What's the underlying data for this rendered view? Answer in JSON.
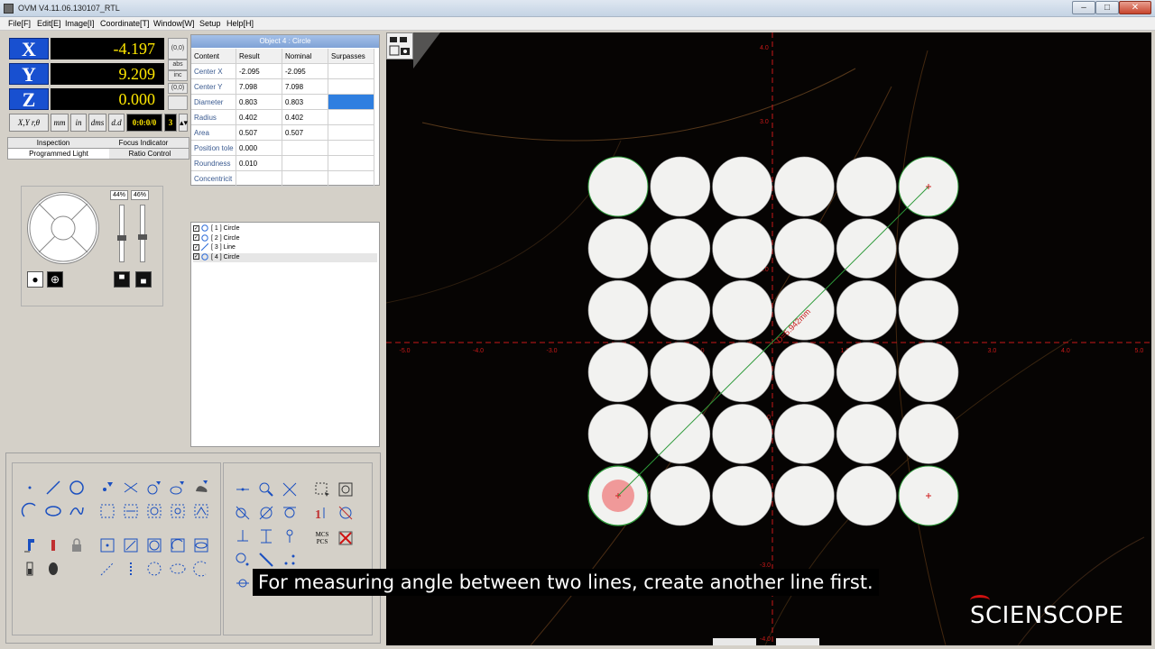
{
  "window": {
    "title": "OVM V4.11.06.130107_RTL"
  },
  "menu": [
    "File[F]",
    "Edit[E]",
    "Image[I]",
    "Coordinate[T]",
    "Window[W]",
    "Setup",
    "Help[H]"
  ],
  "dro": {
    "x_label": "X",
    "x_value": "-4.197",
    "y_label": "Y",
    "y_value": "9.209",
    "z_label": "Z",
    "z_value": "0.000",
    "btn_x": "(0,0)",
    "btn_y": "(0,0)",
    "btn_abs": "abs",
    "btn_inc": "inc",
    "coord_mode": "X,Y r,θ",
    "unit_mm": "mm",
    "unit_in": "in",
    "angle_dms": "dms",
    "angle_dd": "d.d",
    "angle_value": "0:0:0/0",
    "decimals": "3"
  },
  "tabs": {
    "row1": [
      "Inspection",
      "Focus Indicator"
    ],
    "row2": [
      "Programmed Light",
      "Ratio Control"
    ]
  },
  "light": {
    "pct_left": "44%",
    "pct_right": "46%",
    "slider_left": 0.44,
    "slider_right": 0.46
  },
  "object": {
    "header": "Object 4 : Circle",
    "columns": [
      "Content",
      "Result",
      "Nominal",
      "Surpasses"
    ],
    "rows": [
      {
        "content": "Center X",
        "result": "-2.095",
        "nominal": "-2.095",
        "surpasses": ""
      },
      {
        "content": "Center Y",
        "result": "7.098",
        "nominal": "7.098",
        "surpasses": ""
      },
      {
        "content": "Diameter",
        "result": "0.803",
        "nominal": "0.803",
        "surpasses": ""
      },
      {
        "content": "Radius",
        "result": "0.402",
        "nominal": "0.402",
        "surpasses": ""
      },
      {
        "content": "Area",
        "result": "0.507",
        "nominal": "0.507",
        "surpasses": ""
      },
      {
        "content": "Position tole",
        "result": "0.000",
        "nominal": "",
        "surpasses": ""
      },
      {
        "content": "Roundness",
        "result": "0.010",
        "nominal": "",
        "surpasses": ""
      },
      {
        "content": "Concentricit",
        "result": "",
        "nominal": "",
        "surpasses": ""
      }
    ]
  },
  "features": [
    {
      "label": "[ 1 ] Circle",
      "type": "circle",
      "checked": true
    },
    {
      "label": "[ 2 ] Circle",
      "type": "circle",
      "checked": true
    },
    {
      "label": "[ 3 ] Line",
      "type": "line",
      "checked": true
    },
    {
      "label": "[ 4 ] Circle",
      "type": "circle",
      "checked": true
    }
  ],
  "tools": {
    "mcs_label": "MCS",
    "pcs_label": "PCS"
  },
  "image": {
    "measurement_label": "D=5.942mm",
    "x_ticks": [
      "-5.0",
      "-4.0",
      "-3.0",
      "-2.0",
      "-1.0",
      "0",
      "1.0",
      "2.0",
      "3.0",
      "4.0",
      "5.0"
    ],
    "y_ticks": [
      "4.0",
      "3.0",
      "2.0",
      "1.0",
      "0",
      "-1.0",
      "-2.0",
      "-3.0",
      "-4.0"
    ],
    "axis_color": "#c81818",
    "fit_color": "#2e9a3a"
  },
  "caption": "For measuring angle between two lines, create another line first.",
  "logo": "SCIENSCOPE"
}
